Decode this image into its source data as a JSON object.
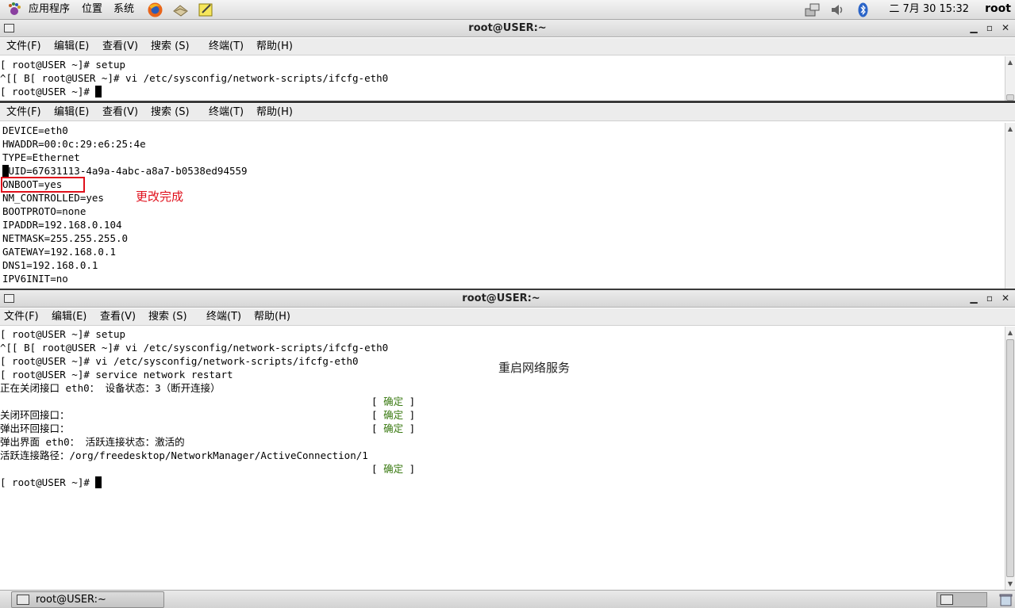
{
  "top_panel": {
    "menu_apps": "应用程序",
    "menu_places": "位置",
    "menu_system": "系统",
    "clock": "二 7月 30 15:32",
    "user": "root"
  },
  "terminal_window": {
    "title": "root@USER:~"
  },
  "menubar": {
    "file": "文件(F)",
    "edit": "编辑(E)",
    "view": "查看(V)",
    "search": "搜索 (S)",
    "terminal": "终端(T)",
    "help": "帮助(H)"
  },
  "pane1": {
    "lines": [
      "[ root@USER ~]# setup",
      "^[[ B[ root@USER ~]# vi /etc/sysconfig/network-scripts/ifcfg-eth0",
      "[ root@USER ~]# "
    ]
  },
  "pane2": {
    "lines": [
      "DEVICE=eth0",
      "HWADDR=00:0c:29:e6:25:4e",
      "TYPE=Ethernet",
      "UUID=67631113-4a9a-4abc-a8a7-b0538ed94559",
      "ONBOOT=yes",
      "NM_CONTROLLED=yes",
      "BOOTPROTO=none",
      "IPADDR=192.168.0.104",
      "NETMASK=255.255.255.0",
      "GATEWAY=192.168.0.1",
      "DNS1=192.168.0.1",
      "IPV6INIT=no"
    ],
    "annotation": "更改完成"
  },
  "pane3": {
    "lines": [
      "[ root@USER ~]# setup",
      "^[[ B[ root@USER ~]# vi /etc/sysconfig/network-scripts/ifcfg-eth0",
      "[ root@USER ~]# vi /etc/sysconfig/network-scripts/ifcfg-eth0",
      "[ root@USER ~]# service network restart",
      "正在关闭接口 eth0： 设备状态：3（断开连接）",
      "",
      "关闭环回接口：",
      "弹出环回接口：",
      "弹出界面 eth0： 活跃连接状态：激活的",
      "活跃连接路径：/org/freedesktop/NetworkManager/ActiveConnection/1",
      "",
      "[ root@USER ~]# "
    ],
    "ok_text": "确定",
    "annotation": "重启网络服务"
  },
  "taskbar": {
    "task_label": "root@USER:~"
  },
  "colors": {
    "annotation_red": "#e0101c",
    "ok_green": "#3a7a12"
  }
}
